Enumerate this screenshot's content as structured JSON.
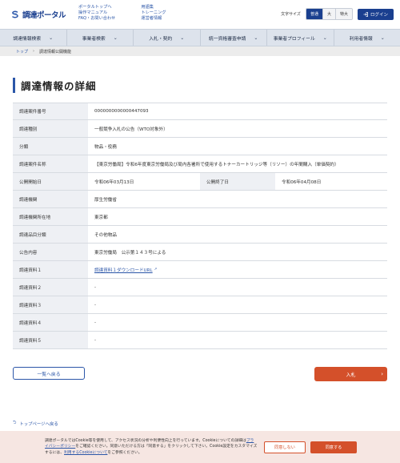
{
  "header": {
    "logo_text": "調達ポータル",
    "links_col1": [
      "ポータルトップへ",
      "操作マニュアル",
      "FAQ・お問い合わせ"
    ],
    "links_col2": [
      "用語集",
      "トレーニング",
      "運営者情報"
    ],
    "font_size_label": "文字サイズ",
    "font_sizes": [
      "普通",
      "大",
      "特大"
    ],
    "login_label": "ログイン"
  },
  "nav": {
    "items": [
      "調達情報検索",
      "事業者検索",
      "入札・契約",
      "統一資格審査申請",
      "事業者プロフィール",
      "利用者情報"
    ]
  },
  "breadcrumb": {
    "home": "トップ",
    "current": "調達情報公開機能"
  },
  "page_title": "調達情報の詳細",
  "details": {
    "case_number_label": "調達案件番号",
    "case_number": "0000000000000447093",
    "type_label": "調達種別",
    "type": "一般競争入札の公告（WTO対象外）",
    "category_label": "分類",
    "category": "物品・役務",
    "name_label": "調達案件名称",
    "name": "【東京労働局】令和6年度東京労働局及び局内各署所で使用するトナーカートリッジ等（リソー）の年間購入（単価契約）",
    "start_label": "公開開始日",
    "start": "令和06年03月13日",
    "end_label": "公開終了日",
    "end": "令和06年04月08日",
    "agency_label": "調達機関",
    "agency": "厚生労働省",
    "location_label": "調達機関所在地",
    "location": "東京都",
    "item_category_label": "調達品目分類",
    "item_category": "その他物品",
    "notice_label": "公告内容",
    "notice": "東京労働局　公示第１４３号による",
    "doc1_label": "調達資料１",
    "doc1": "調達資料１ダウンロードURL",
    "doc2_label": "調達資料２",
    "doc2": "-",
    "doc3_label": "調達資料３",
    "doc3": "-",
    "doc4_label": "調達資料４",
    "doc4": "-",
    "doc5_label": "調達資料５",
    "doc5": "-"
  },
  "buttons": {
    "back": "一覧へ戻る",
    "bid": "入札"
  },
  "to_top": "トップページへ戻る",
  "cookie": {
    "text_1": "調達ポータルではCookie等を使用して、アクセス状況の分析や利便性向上を行っています。Cookieについての詳細は",
    "policy_link": "プライバシーポリシー",
    "text_2": "をご確認ください。同意いただける方は「同意する」をクリックして下さい。Cookie設定をカスタマイズするには、",
    "settings_link": "利用するCookieについて",
    "text_3": "をご参照ください。",
    "decline": "同意しない",
    "accept": "同意する"
  },
  "colors": {
    "brand": "#1a3f8f",
    "accent": "#d4502a",
    "nav_bg": "#dde3ec",
    "label_bg": "#eef0f4",
    "cookie_bg": "#f6e6e2"
  }
}
